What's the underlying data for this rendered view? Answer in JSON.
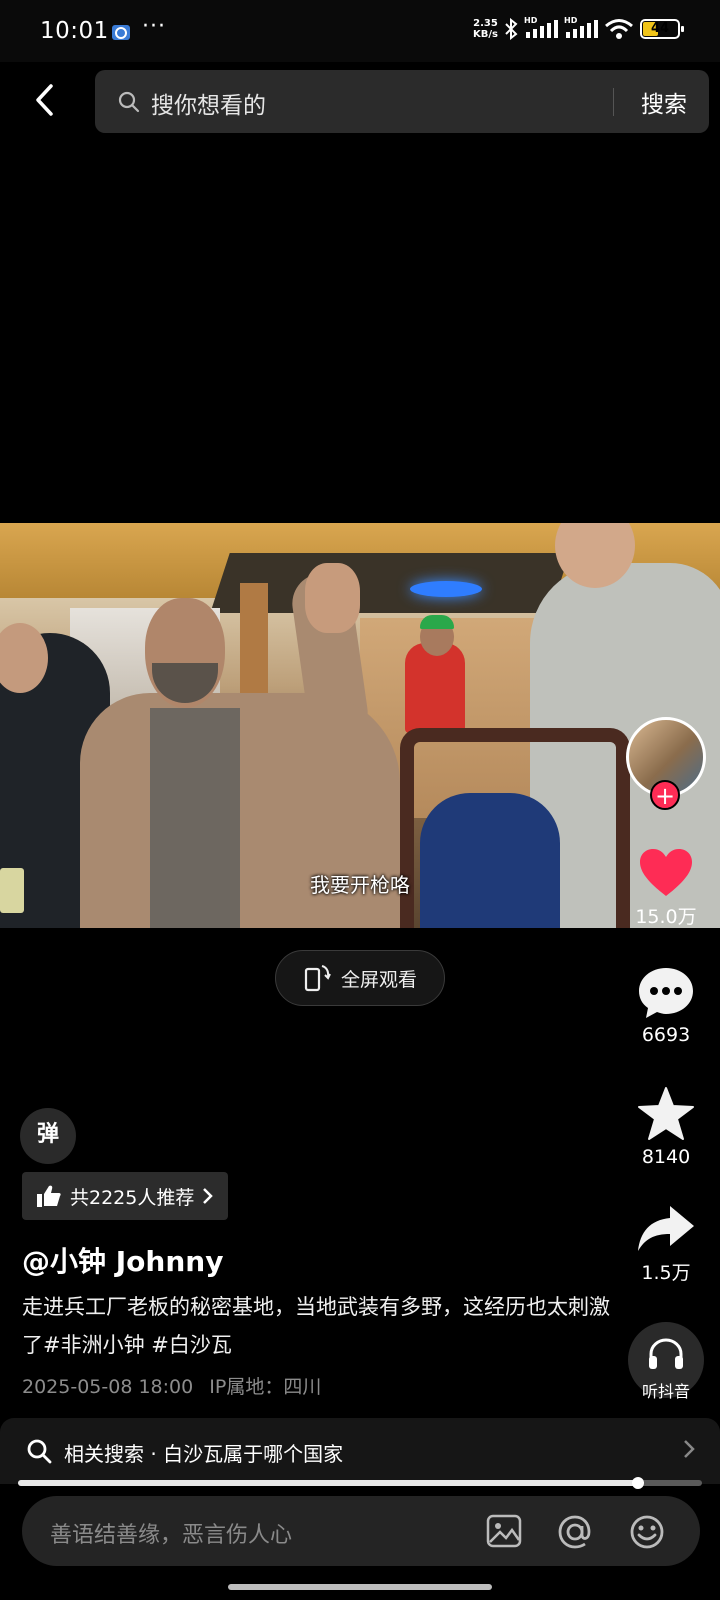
{
  "status_bar": {
    "time": "10:01",
    "more": "···",
    "net_speed_value": "2.35",
    "net_speed_unit": "KB/s",
    "hd1": "HD",
    "hd2": "HD",
    "battery": "44",
    "battery_level": 0.44,
    "battery_color": "#f0c419"
  },
  "search": {
    "placeholder": "搜你想看的",
    "button_label": "搜索"
  },
  "video": {
    "subtitle": "我要开枪咯"
  },
  "fullscreen": {
    "label": "全屏观看"
  },
  "rail": {
    "like_count": "15.0万",
    "comment_count": "6693",
    "favorite_count": "8140",
    "share_count": "1.5万",
    "listen_label": "听抖音",
    "follow_symbol": "+",
    "like_color": "#fe2c55"
  },
  "caption": {
    "danmaku_label": "弹",
    "recommend_label": "共2225人推荐",
    "author": "@小钟 Johnny",
    "description": "走进兵工厂老板的秘密基地，当地武装有多野，这经历也太刺激了#非洲小钟 #白沙瓦",
    "timestamp": "2025-05-08 18:00",
    "ip_location": "IP属地：四川"
  },
  "related": {
    "label": "相关搜索 · 白沙瓦属于哪个国家"
  },
  "playback": {
    "progress": 0.906
  },
  "comment": {
    "placeholder": "善语结善缘，恶言伤人心"
  }
}
